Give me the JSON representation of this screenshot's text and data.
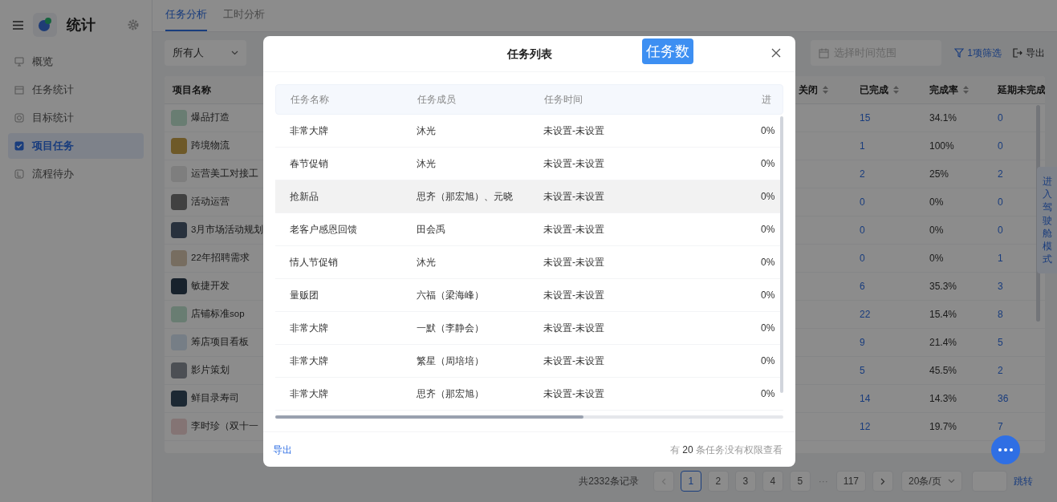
{
  "sidebar": {
    "app_title": "统计",
    "items": [
      {
        "label": "概览",
        "selected": false
      },
      {
        "label": "任务统计",
        "selected": false
      },
      {
        "label": "目标统计",
        "selected": false
      },
      {
        "label": "项目任务",
        "selected": true
      },
      {
        "label": "流程待办",
        "selected": false
      }
    ]
  },
  "tabs": [
    {
      "label": "任务分析",
      "selected": true
    },
    {
      "label": "工时分析",
      "selected": false
    }
  ],
  "filters": {
    "owner": "所有人",
    "date_placeholder": "选择时间范围",
    "filter_button": "1项筛选",
    "export_button": "导出"
  },
  "project_table": {
    "columns": [
      "项目名称",
      "关闭",
      "已完成",
      "完成率",
      "延期未完成"
    ],
    "rows": [
      {
        "name": "爆品打造",
        "completed": "15",
        "rate": "34.1%",
        "overdue": "0"
      },
      {
        "name": "跨境物流",
        "completed": "1",
        "rate": "100%",
        "overdue": "0"
      },
      {
        "name": "运营美工对接工",
        "completed": "2",
        "rate": "25%",
        "overdue": "2"
      },
      {
        "name": "活动运营",
        "completed": "0",
        "rate": "0%",
        "overdue": "0"
      },
      {
        "name": "3月市场活动规划",
        "completed": "0",
        "rate": "0%",
        "overdue": "0"
      },
      {
        "name": "22年招聘需求",
        "completed": "0",
        "rate": "0%",
        "overdue": "1"
      },
      {
        "name": "敏捷开发",
        "completed": "6",
        "rate": "35.3%",
        "overdue": "3"
      },
      {
        "name": "店铺标准sop",
        "completed": "22",
        "rate": "15.4%",
        "overdue": "8"
      },
      {
        "name": "筹店项目看板",
        "completed": "9",
        "rate": "21.4%",
        "overdue": "5"
      },
      {
        "name": "影片策划",
        "completed": "5",
        "rate": "45.5%",
        "overdue": "2"
      },
      {
        "name": "鲜目录寿司",
        "completed": "14",
        "rate": "14.3%",
        "overdue": "36"
      },
      {
        "name": "李时珍（双十一",
        "completed": "12",
        "rate": "19.7%",
        "overdue": "7"
      }
    ]
  },
  "pagination": {
    "total": "共2332条记录",
    "pages": [
      {
        "label": "1",
        "selected": true
      },
      {
        "label": "2",
        "selected": false
      },
      {
        "label": "3",
        "selected": false
      },
      {
        "label": "4",
        "selected": false
      },
      {
        "label": "5",
        "selected": false
      }
    ],
    "ellipsis": "···",
    "last_page": "117",
    "page_size": "20条/页",
    "jump": "跳转"
  },
  "side_button": "进入驾驶舱模式",
  "modal": {
    "title": "任务列表",
    "badge": "任务数",
    "columns": [
      "任务名称",
      "任务成员",
      "任务时间",
      "进"
    ],
    "rows": [
      {
        "name": "非常大牌",
        "members": "沐光",
        "time": "未设置-未设置",
        "progress": "0%",
        "highlighted": false
      },
      {
        "name": "春节促销",
        "members": "沐光",
        "time": "未设置-未设置",
        "progress": "0%",
        "highlighted": false
      },
      {
        "name": "抢新品",
        "members": "思齐（那宏旭）、元晓",
        "time": "未设置-未设置",
        "progress": "0%",
        "highlighted": true
      },
      {
        "name": "老客户感恩回馈",
        "members": "田会禹",
        "time": "未设置-未设置",
        "progress": "0%",
        "highlighted": false
      },
      {
        "name": "情人节促销",
        "members": "沐光",
        "time": "未设置-未设置",
        "progress": "0%",
        "highlighted": false
      },
      {
        "name": "量贩团",
        "members": "六福（梁海峰）",
        "time": "未设置-未设置",
        "progress": "0%",
        "highlighted": false
      },
      {
        "name": "非常大牌",
        "members": "一默（李静会）",
        "time": "未设置-未设置",
        "progress": "0%",
        "highlighted": false
      },
      {
        "name": "非常大牌",
        "members": "繁星（周培培）",
        "time": "未设置-未设置",
        "progress": "0%",
        "highlighted": false
      },
      {
        "name": "非常大牌",
        "members": "思齐（那宏旭）",
        "time": "未设置-未设置",
        "progress": "0%",
        "highlighted": false
      }
    ],
    "export_link": "导出",
    "note": "有 **20** 条任务没有权限查看"
  }
}
